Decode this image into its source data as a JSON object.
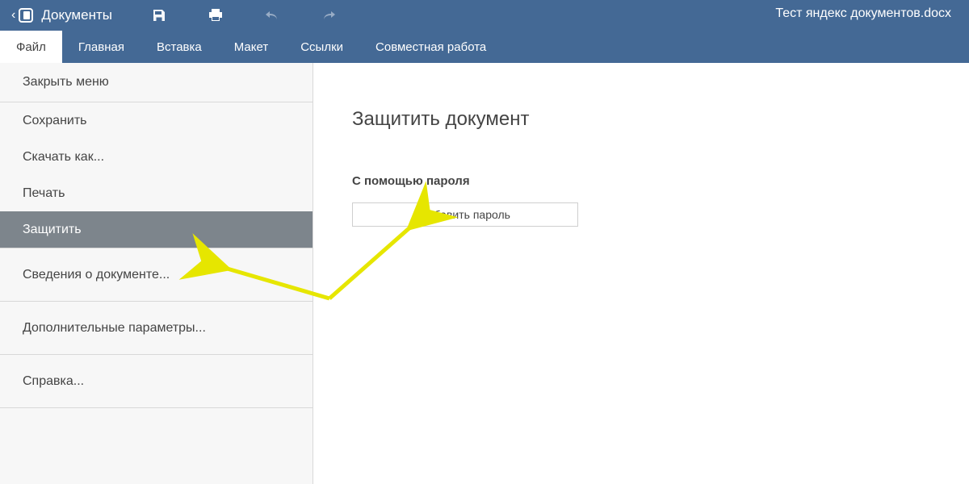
{
  "header": {
    "appTitle": "Документы",
    "docName": "Тест яндекс документов.docx"
  },
  "menubar": {
    "tabs": [
      {
        "label": "Файл",
        "active": true
      },
      {
        "label": "Главная"
      },
      {
        "label": "Вставка"
      },
      {
        "label": "Макет"
      },
      {
        "label": "Ссылки"
      },
      {
        "label": "Совместная работа"
      }
    ]
  },
  "side": {
    "close": "Закрыть меню",
    "save": "Сохранить",
    "download": "Скачать как...",
    "print": "Печать",
    "protect": "Защитить",
    "docinfo": "Сведения о документе...",
    "advanced": "Дополнительные параметры...",
    "help": "Справка..."
  },
  "panel": {
    "title": "Защитить документ",
    "sub": "С помощью пароля",
    "btn": "Добавить пароль"
  }
}
